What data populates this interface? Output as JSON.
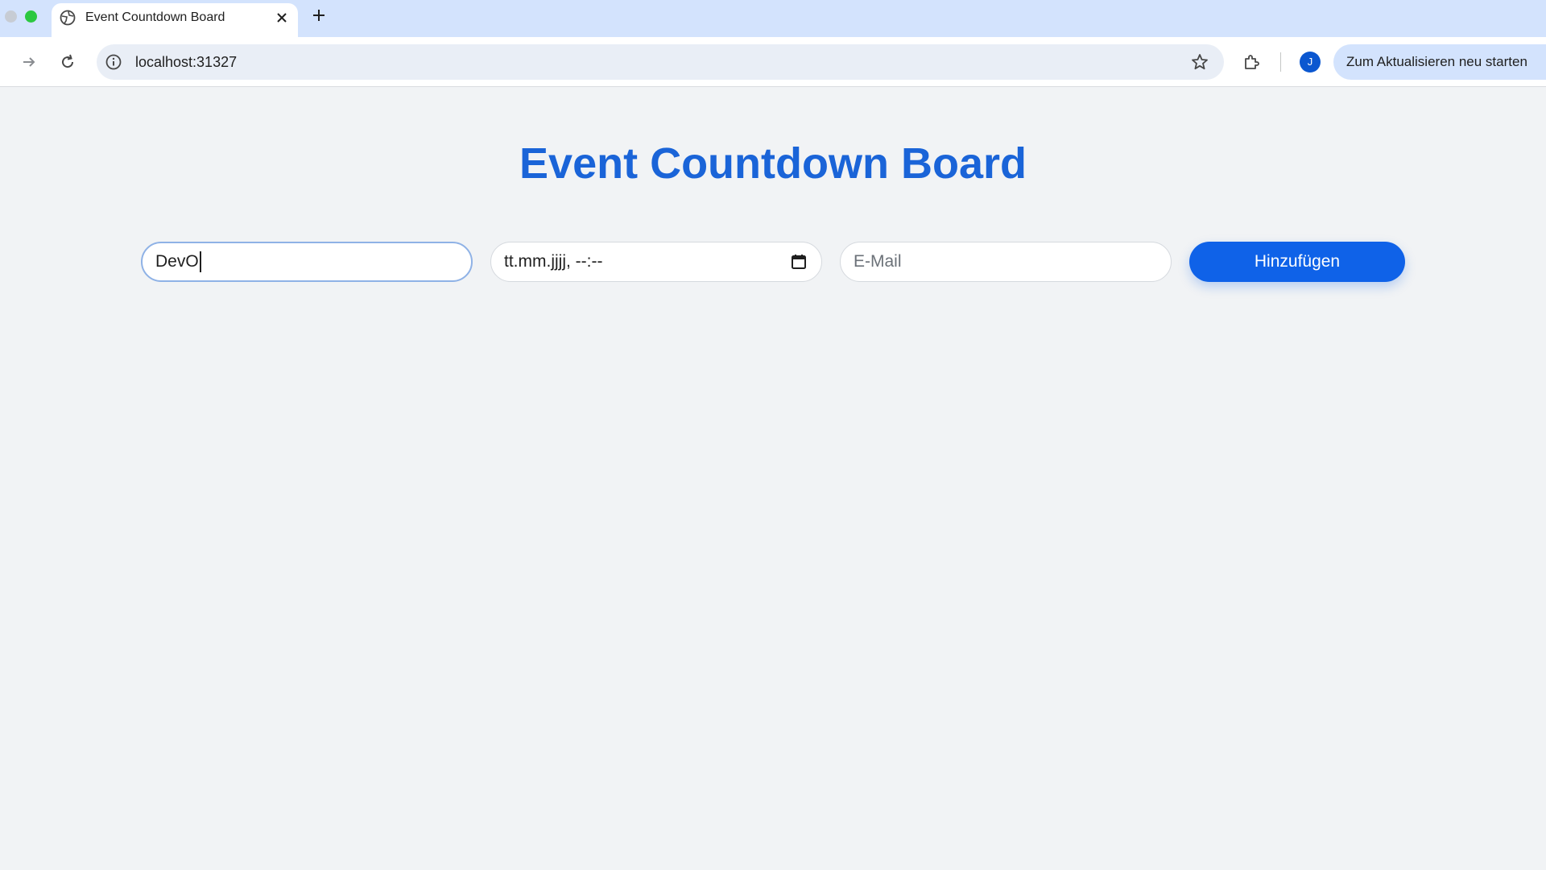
{
  "browser": {
    "tab": {
      "title": "Event Countdown Board"
    },
    "address_bar": {
      "url": "localhost:31327"
    },
    "profile_initial": "J",
    "update_button_label": "Zum Aktualisieren neu starten"
  },
  "page": {
    "title": "Event Countdown Board",
    "form": {
      "name_value": "DevO",
      "date_placeholder": "tt.mm.jjjj, --:--",
      "email_placeholder": "E-Mail",
      "submit_label": "Hinzufügen"
    }
  },
  "colors": {
    "accent": "#0f62e8",
    "title": "#1a64d8",
    "background": "#f1f3f5"
  }
}
